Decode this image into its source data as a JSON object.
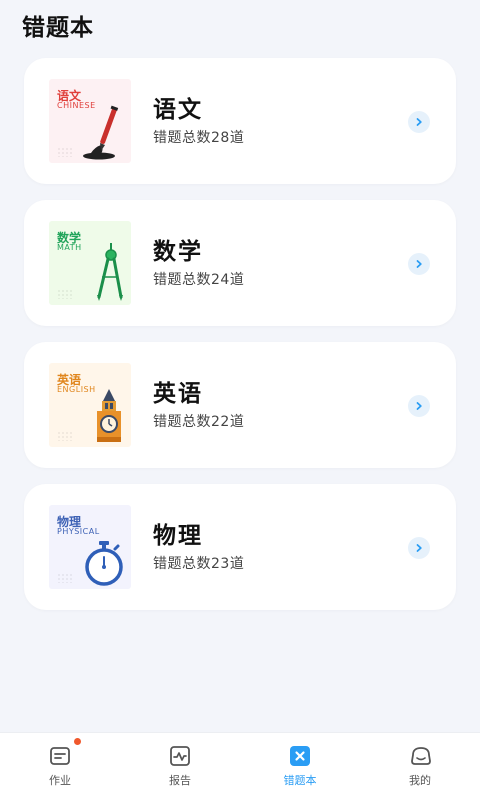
{
  "page": {
    "title": "错题本"
  },
  "subjects": [
    {
      "name": "语文",
      "thumb_zh": "语文",
      "thumb_en": "CHINESE",
      "count_text": "错题总数28道",
      "accent": "#e0403c",
      "thumb_bg": "#fdf1f3",
      "icon": "brush-icon"
    },
    {
      "name": "数学",
      "thumb_zh": "数学",
      "thumb_en": "MATH",
      "count_text": "错题总数24道",
      "accent": "#21a45a",
      "thumb_bg": "#effbe9",
      "icon": "compass-icon"
    },
    {
      "name": "英语",
      "thumb_zh": "英语",
      "thumb_en": "ENGLISH",
      "count_text": "错题总数22道",
      "accent": "#e0861d",
      "thumb_bg": "#fff6ea",
      "icon": "big-ben-icon"
    },
    {
      "name": "物理",
      "thumb_zh": "物理",
      "thumb_en": "PHYSICAL",
      "count_text": "错题总数23道",
      "accent": "#3e62b5",
      "thumb_bg": "#f3f3fd",
      "icon": "stopwatch-icon"
    }
  ],
  "tabbar": {
    "items": [
      {
        "label": "作业",
        "icon": "homework-icon",
        "has_badge": true
      },
      {
        "label": "报告",
        "icon": "report-icon"
      },
      {
        "label": "错题本",
        "icon": "mistakes-book-icon",
        "active": true
      },
      {
        "label": "我的",
        "icon": "profile-icon"
      }
    ],
    "active_color": "#2a9df4",
    "badge_color": "#f0582c"
  }
}
